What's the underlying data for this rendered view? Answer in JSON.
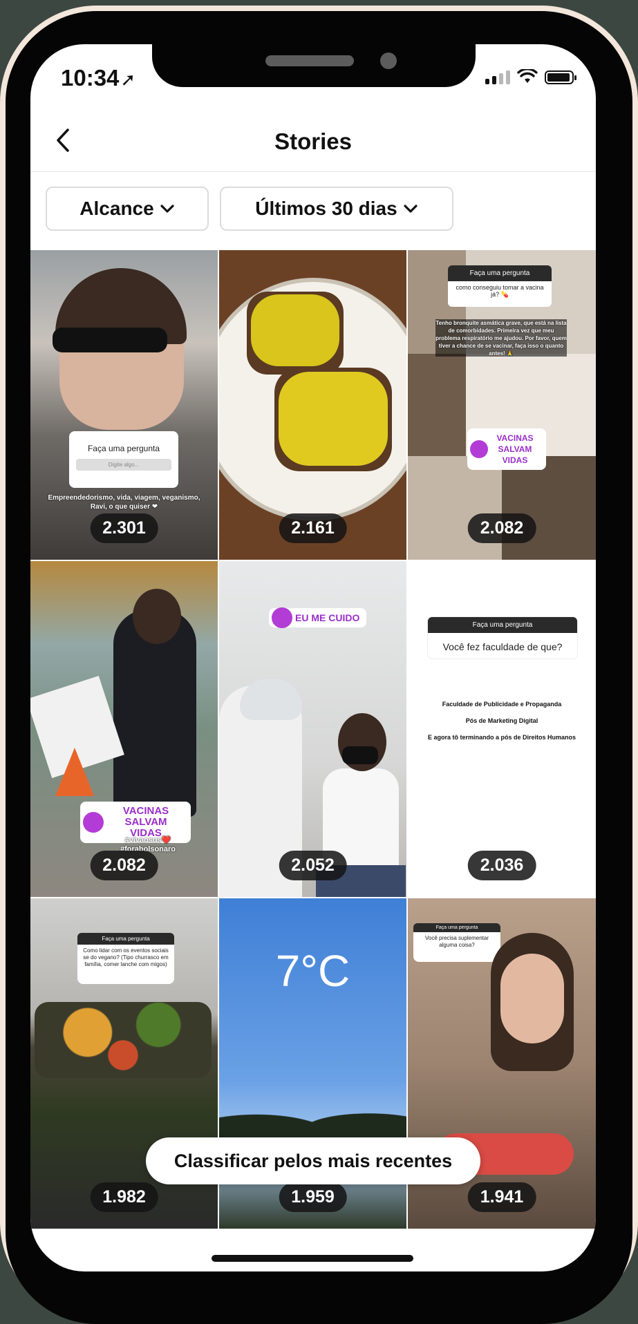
{
  "status": {
    "time": "10:34",
    "location_icon": "location-arrow-icon"
  },
  "header": {
    "title": "Stories",
    "back_icon": "chevron-left-icon"
  },
  "filters": [
    {
      "label": "Alcance"
    },
    {
      "label": "Últimos 30 dias"
    }
  ],
  "stories": [
    {
      "count": "2.301",
      "question_title": "Faça uma pergunta",
      "question_placeholder": "Digite algo...",
      "caption": "Empreendedorismo, vida, viagem, veganismo, Ravi, o que quiser ❤"
    },
    {
      "count": "2.161"
    },
    {
      "count": "2.082",
      "question_title": "Faça uma pergunta",
      "question_text": "como conseguiu tomar a vacina já? 💊",
      "caption": "Tenho bronquite asmática grave, que está na lista de comorbidades. Primeira vez que meu problema respiratório me ajudou. Por favor, quem tiver a chance de se vacinar, faça isso o quanto antes! 🙏",
      "sticker": "VACINAS SALVAM VIDAS"
    },
    {
      "count": "2.082",
      "sticker": "VACINAS SALVAM VIDAS",
      "caption": "#vivaosus❤️ #forabolsonaro"
    },
    {
      "count": "2.052",
      "sticker": "EU ME CUIDO"
    },
    {
      "count": "2.036",
      "question_title": "Faça uma pergunta",
      "question_text": "Você fez faculdade de que?",
      "answer": [
        "Faculdade de Publicidade e Propaganda",
        "Pós de Marketing Digital",
        "E agora tô terminando a pós de Direitos Humanos"
      ]
    },
    {
      "count": "1.982",
      "question_title": "Faça uma pergunta",
      "question_text": "Como lidar com os eventos sociais se do vegano? (Tipo churrasco em família, comer lanche com migos)"
    },
    {
      "count": "1.959",
      "temperature": "7°C"
    },
    {
      "count": "1.941",
      "question_title": "Faça uma pergunta",
      "question_text": "Você precisa suplementar alguma coisa?"
    }
  ],
  "sort_toast": "Classificar pelos mais recentes",
  "colors": {
    "accent_purple": "#b33bd6",
    "pill_bg": "#1e1e1e"
  }
}
